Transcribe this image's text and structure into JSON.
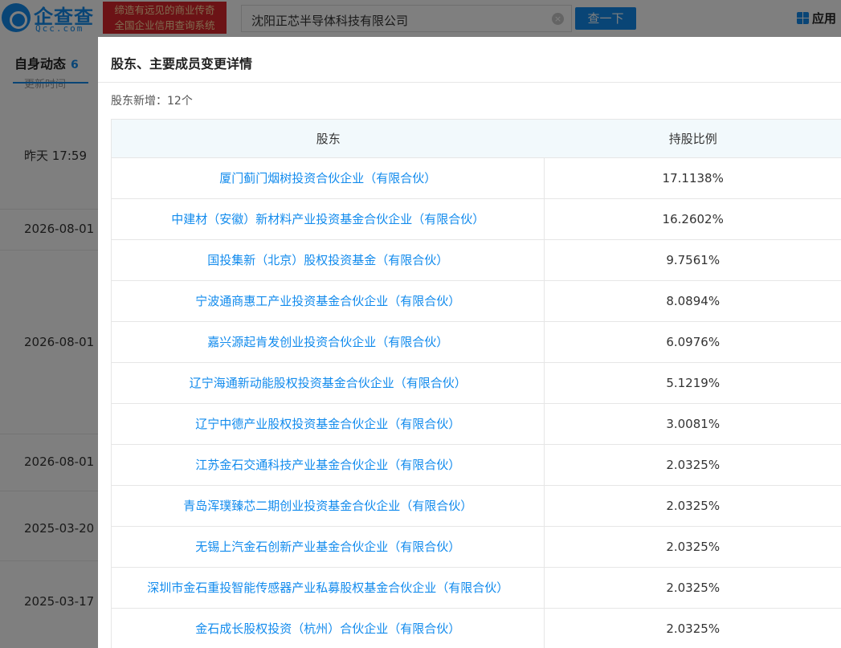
{
  "header": {
    "logo_text": "企查查",
    "logo_domain": "Qcc.com",
    "slogan_line1": "缔造有远见的商业传奇",
    "slogan_line2": "全国企业信用查询系统",
    "search_value": "沈阳正芯半导体科技有限公司",
    "search_button": "查一下",
    "apps_label": "应用"
  },
  "left_panel": {
    "tab_label": "自身动态",
    "tab_count": "6",
    "column_label": "更新时间",
    "dates": [
      "昨天 17:59",
      "2026-08-01",
      "2026-08-01",
      "2026-08-01",
      "2025-03-20",
      "2025-03-17"
    ]
  },
  "modal": {
    "title": "股东、主要成员变更详情",
    "summary": "股东新增：12个",
    "columns": [
      "股东",
      "持股比例"
    ],
    "rows": [
      {
        "shareholder": "厦门蓟门烟树投资合伙企业（有限合伙）",
        "ratio": "17.1138%"
      },
      {
        "shareholder": "中建材（安徽）新材料产业投资基金合伙企业（有限合伙）",
        "ratio": "16.2602%"
      },
      {
        "shareholder": "国投集新（北京）股权投资基金（有限合伙）",
        "ratio": "9.7561%"
      },
      {
        "shareholder": "宁波通商惠工产业投资基金合伙企业（有限合伙）",
        "ratio": "8.0894%"
      },
      {
        "shareholder": "嘉兴源起肯发创业投资合伙企业（有限合伙）",
        "ratio": "6.0976%"
      },
      {
        "shareholder": "辽宁海通新动能股权投资基金合伙企业（有限合伙）",
        "ratio": "5.1219%"
      },
      {
        "shareholder": "辽宁中德产业股权投资基金合伙企业（有限合伙）",
        "ratio": "3.0081%"
      },
      {
        "shareholder": "江苏金石交通科技产业基金合伙企业（有限合伙）",
        "ratio": "2.0325%"
      },
      {
        "shareholder": "青岛浑璞臻芯二期创业投资基金合伙企业（有限合伙）",
        "ratio": "2.0325%"
      },
      {
        "shareholder": "无锡上汽金石创新产业基金合伙企业（有限合伙）",
        "ratio": "2.0325%"
      },
      {
        "shareholder": "深圳市金石重投智能传感器产业私募股权基金合伙企业（有限合伙）",
        "ratio": "2.0325%"
      },
      {
        "shareholder": "金石成长股权投资（杭州）合伙企业（有限合伙）",
        "ratio": "2.0325%"
      }
    ]
  },
  "colors": {
    "brand_blue": "#128bed",
    "slogan_red": "#d8262c",
    "table_header_bg": "#f2f9fc"
  }
}
